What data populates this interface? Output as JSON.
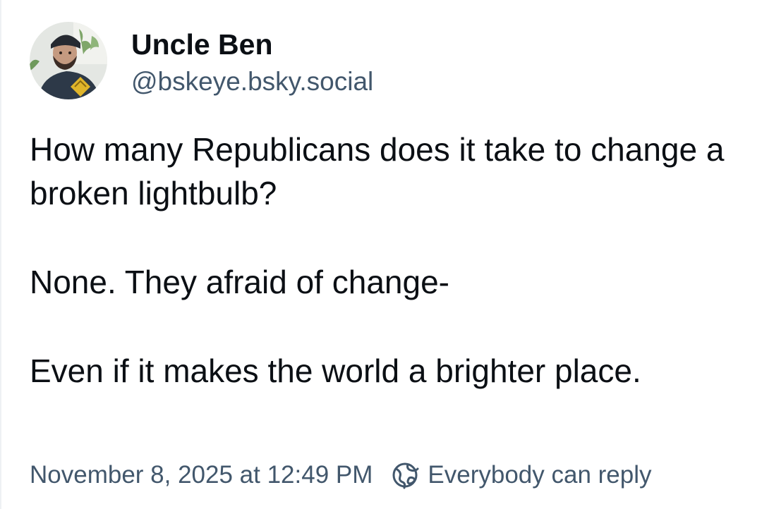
{
  "author": {
    "display_name": "Uncle Ben",
    "handle": "@bskeye.bsky.social",
    "avatar_icon": "user-avatar-photo"
  },
  "post": {
    "paragraphs": [
      "How many Republicans does it take to change a broken lightbulb?",
      "None. They afraid of change-",
      "Even if it makes the world a brighter place."
    ]
  },
  "meta": {
    "timestamp": "November 8, 2025 at 12:49 PM",
    "reply_setting_icon": "globe-icon",
    "reply_setting": "Everybody can reply"
  },
  "colors": {
    "text": "#0b0f14",
    "muted": "#42576c",
    "background": "#ffffff"
  }
}
